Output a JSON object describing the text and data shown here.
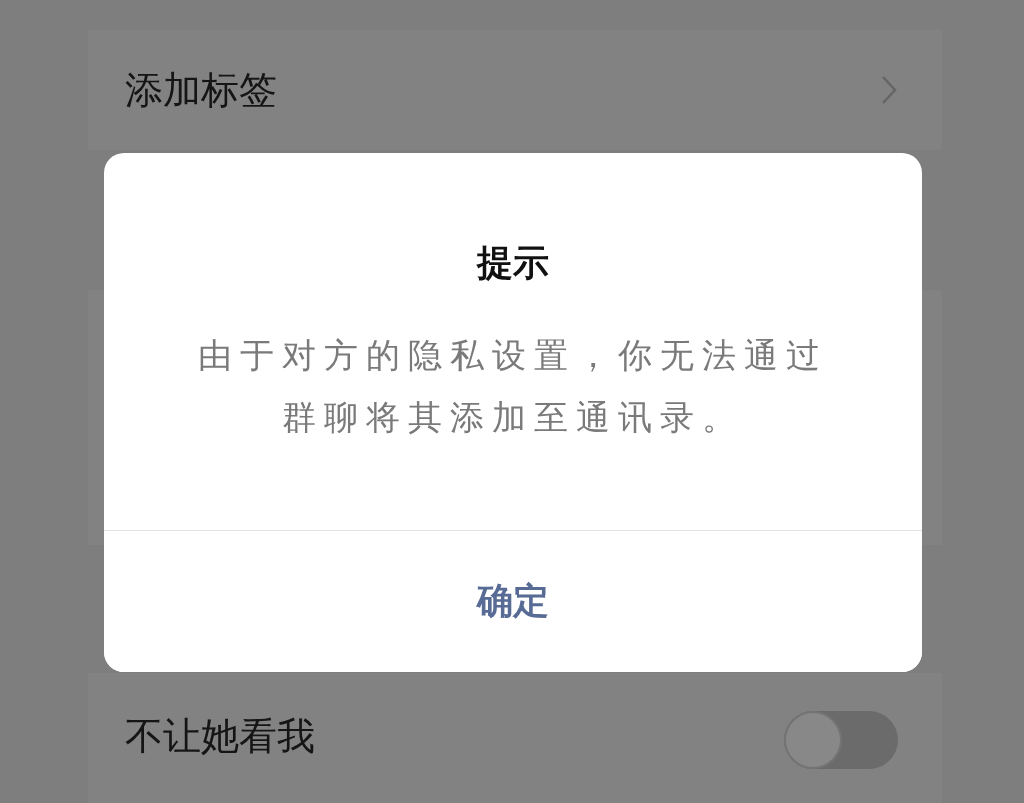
{
  "tag_row": {
    "label": "添加标签"
  },
  "toggle_row": {
    "label": "不让她看我",
    "on": false
  },
  "dialog": {
    "title": "提示",
    "message": "由于对方的隐私设置，你无法通过群聊将其添加至通讯录。",
    "button": "确定"
  }
}
